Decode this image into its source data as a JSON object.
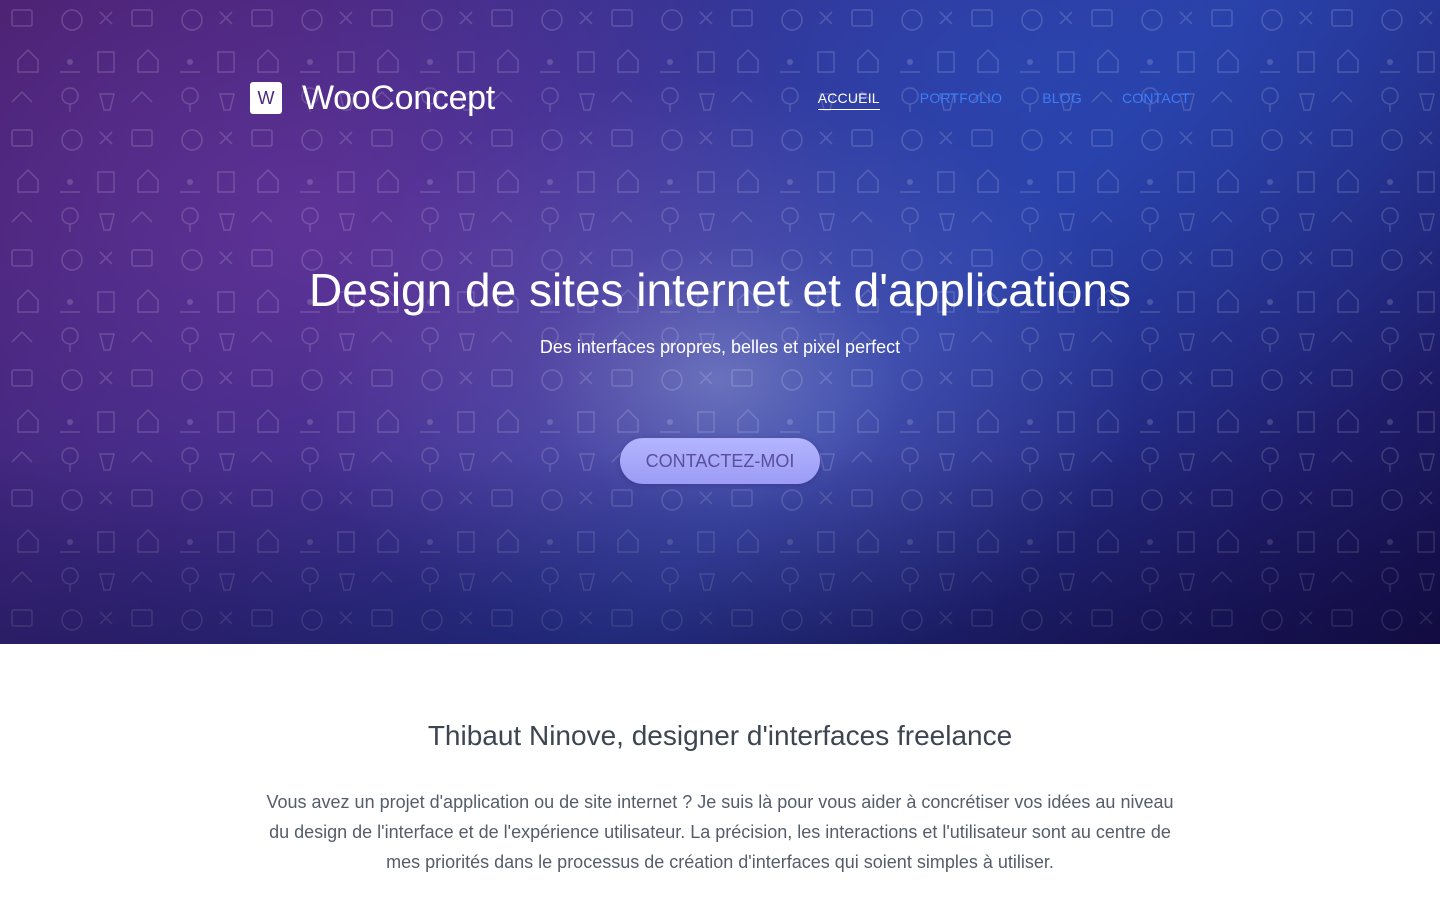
{
  "header": {
    "logo_letter": "W",
    "brand": "WooConcept"
  },
  "nav": {
    "items": [
      {
        "label": "ACCUEIL",
        "active": true
      },
      {
        "label": "PORTFOLIO",
        "active": false
      },
      {
        "label": "BLOG",
        "active": false
      },
      {
        "label": "CONTACT",
        "active": false
      }
    ]
  },
  "hero": {
    "title": "Design de sites internet et d'applications",
    "subtitle": "Des interfaces propres, belles et pixel perfect",
    "cta_label": "CONTACTEZ-MOI"
  },
  "about": {
    "title": "Thibaut Ninove, designer d'interfaces freelance",
    "text": "Vous avez un projet d'application ou de site internet ? Je suis là pour vous aider à concrétiser vos idées au niveau du design de l'interface et de l'expérience utilisateur. La précision, les interactions et l'utilisateur sont au centre de mes priorités dans le processus de création d'interfaces qui soient simples à utiliser."
  },
  "colors": {
    "nav_link": "#3f7cf5",
    "nav_active": "#ffffff",
    "cta_background": "#a8a9fb",
    "cta_text": "#5a4f9a",
    "hero_gradient_start": "#4a2070",
    "hero_gradient_end": "#150f4a"
  },
  "icons": [
    "logo-w-icon",
    "hero-background-icon-pattern"
  ]
}
